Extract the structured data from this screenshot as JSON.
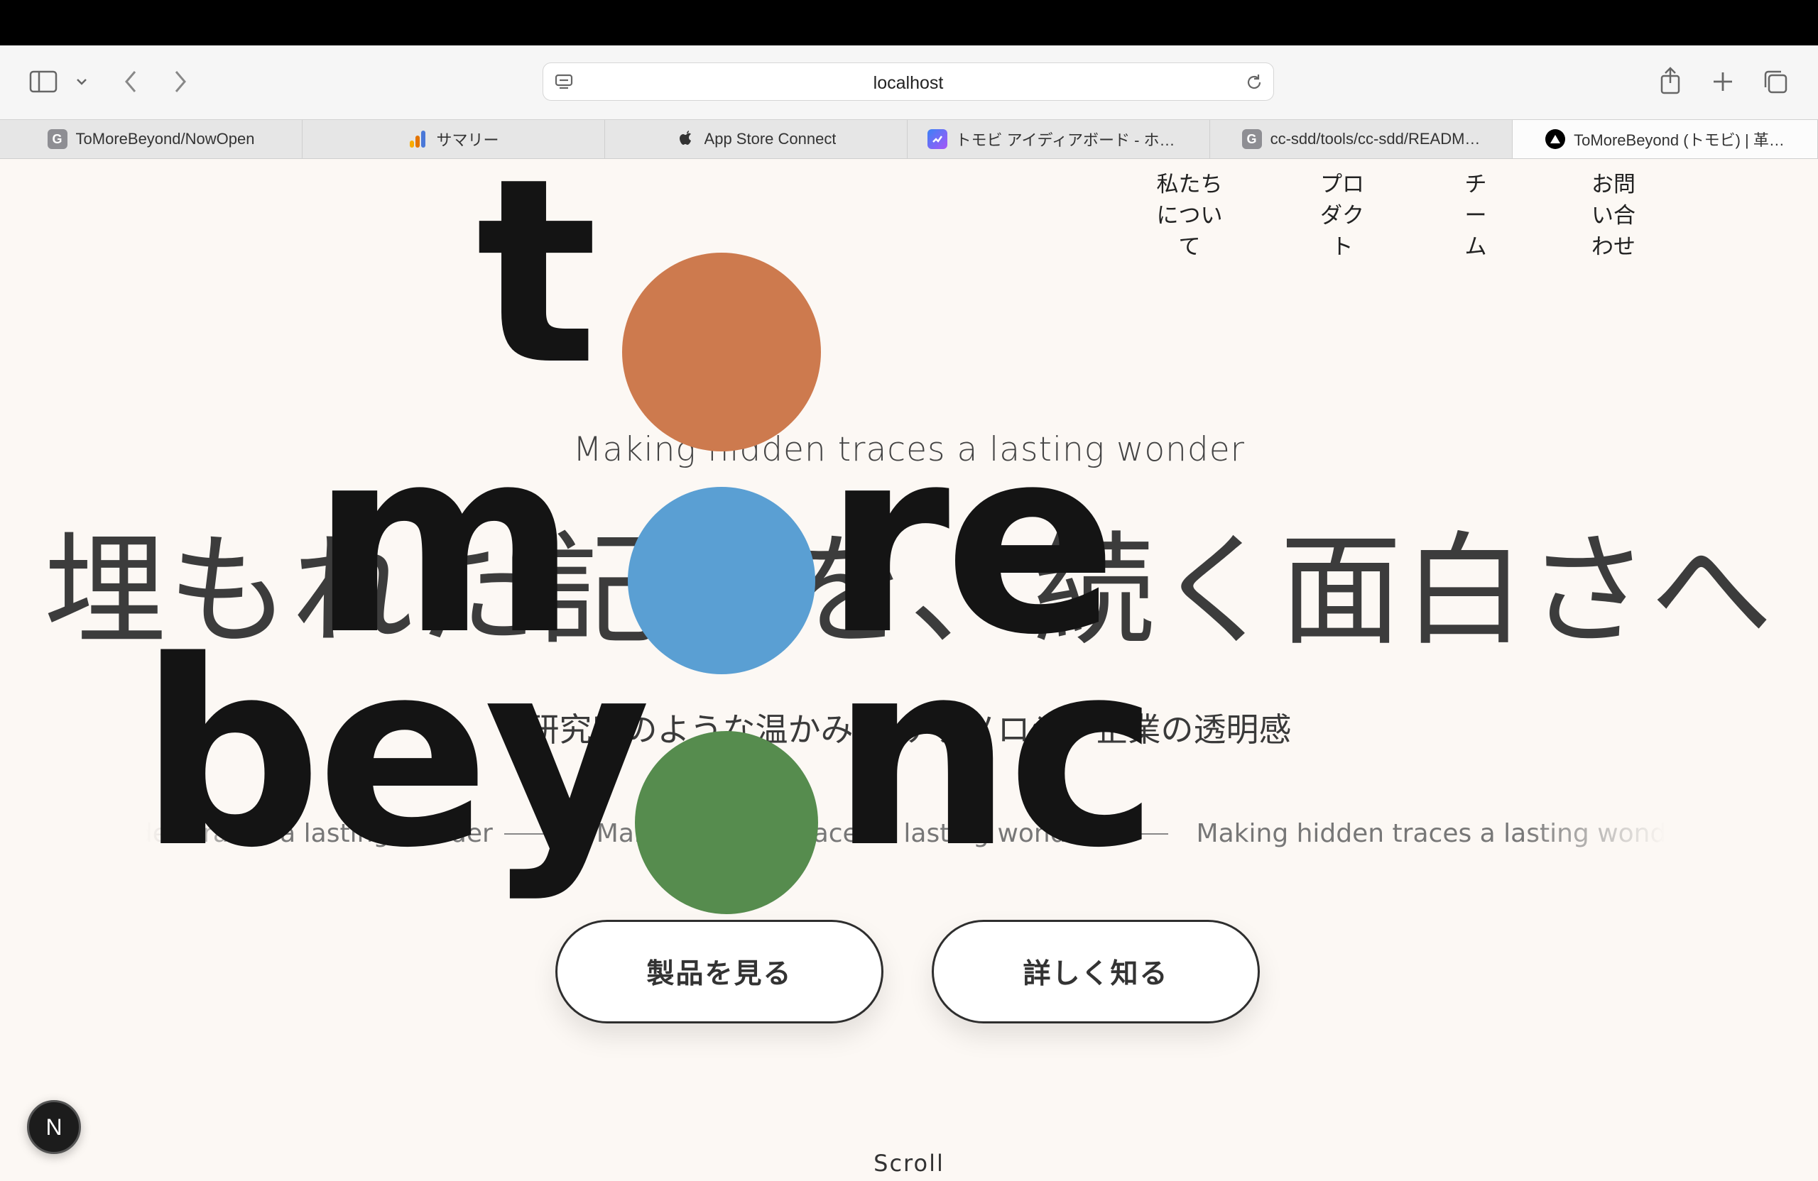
{
  "browser": {
    "url": "localhost",
    "tabs": [
      {
        "label": "ToMoreBeyond/NowOpen",
        "favicon": "G",
        "favicon_color": "#8e8e93"
      },
      {
        "label": "サマリー",
        "favicon": "analytics",
        "favicon_color": "#f4a300"
      },
      {
        "label": "App Store Connect",
        "favicon": "apple",
        "favicon_color": "#222222"
      },
      {
        "label": "トモビ アイディアボード - ホワイ…",
        "favicon": "board",
        "favicon_color": "#5b5bf0"
      },
      {
        "label": "cc-sdd/tools/cc-sdd/READM…",
        "favicon": "G",
        "favicon_color": "#8e8e93"
      },
      {
        "label": "ToMoreBeyond (トモビ) | 革…",
        "favicon": "triangle",
        "favicon_color": "#000000",
        "active": true
      }
    ]
  },
  "nav": {
    "items": [
      {
        "label": "私たち\nについ\nて"
      },
      {
        "label": "プロ\nダク\nト"
      },
      {
        "label": "チ\nー\nム"
      },
      {
        "label": "お問\nい合\nわせ"
      }
    ]
  },
  "hero": {
    "wordmark_line1": "t",
    "wordmark_line2_a": "m",
    "wordmark_line2_b": "re",
    "wordmark_line3_a": "bey",
    "wordmark_line3_b": "nc",
    "circle_colors": [
      "#cd7a4e",
      "#5a9fd3",
      "#568c4e"
    ],
    "tagline_en": "Making hidden traces a lasting wonder",
    "headline_jp": "埋もれた記録を、続く面白さへ",
    "sub_jp": "研究所のような温かみ × テクノロジー企業の透明感",
    "marquee_text": "Making hidden traces a lasting wonder",
    "buttons": {
      "primary": "製品を見る",
      "secondary": "詳しく知る"
    },
    "scroll_label": "Scroll"
  },
  "next_badge": "N"
}
